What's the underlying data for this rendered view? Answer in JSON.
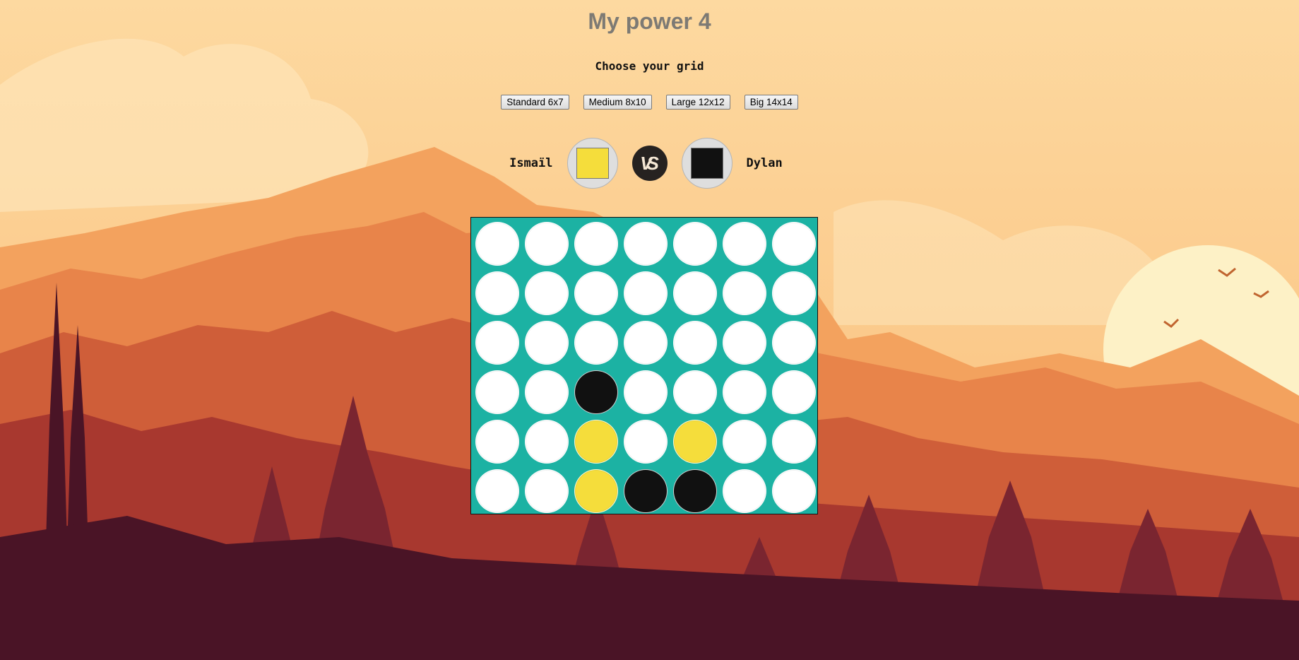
{
  "page": {
    "title": "My power 4"
  },
  "grid_selector": {
    "heading": "Choose your grid",
    "options": [
      {
        "label": "Standard 6x7"
      },
      {
        "label": "Medium 8x10"
      },
      {
        "label": "Large 12x12"
      },
      {
        "label": "Big 14x14"
      }
    ]
  },
  "players": {
    "player1": {
      "name": "Ismaïl",
      "color": "#f5dd3b"
    },
    "player2": {
      "name": "Dylan",
      "color": "#111111"
    },
    "versus_icon": "vs-badge-icon"
  },
  "colors": {
    "board": "#1cb2a3",
    "empty": "#ffffff",
    "yellow": "#f5dd3b",
    "black": "#111111"
  },
  "board": {
    "rows": 6,
    "cols": 7,
    "cells": [
      [
        "empty",
        "empty",
        "empty",
        "empty",
        "empty",
        "empty",
        "empty"
      ],
      [
        "empty",
        "empty",
        "empty",
        "empty",
        "empty",
        "empty",
        "empty"
      ],
      [
        "empty",
        "empty",
        "empty",
        "empty",
        "empty",
        "empty",
        "empty"
      ],
      [
        "empty",
        "empty",
        "black",
        "empty",
        "empty",
        "empty",
        "empty"
      ],
      [
        "empty",
        "empty",
        "yellow",
        "empty",
        "yellow",
        "empty",
        "empty"
      ],
      [
        "empty",
        "empty",
        "yellow",
        "black",
        "black",
        "empty",
        "empty"
      ]
    ]
  }
}
